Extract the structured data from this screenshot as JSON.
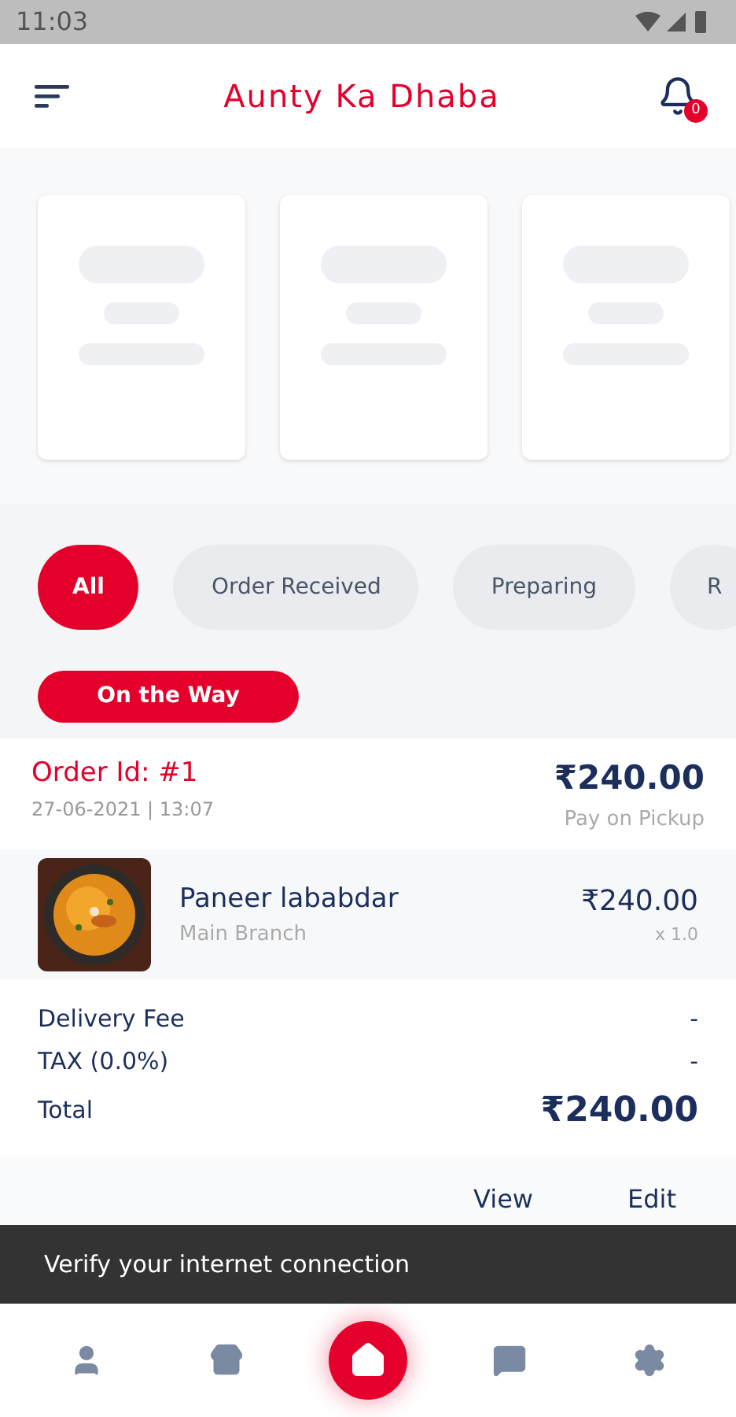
{
  "status_bar": {
    "time": "11:03"
  },
  "header": {
    "title": "Aunty Ka Dhaba",
    "notification_count": "0"
  },
  "filters": [
    {
      "label": "All",
      "selected": true
    },
    {
      "label": "Order Received",
      "selected": false
    },
    {
      "label": "Preparing",
      "selected": false
    },
    {
      "label": "R",
      "selected": false
    }
  ],
  "order": {
    "status": "On the Way",
    "id": "Order Id: #1",
    "datetime": "27-06-2021 | 13:07",
    "total": "₹240.00",
    "payment": "Pay on Pickup",
    "items": [
      {
        "kind": "picture",
        "name": "Paneer lababdar",
        "branch": "Main Branch",
        "price": "₹240.00",
        "quantity": "x 1.0"
      }
    ],
    "summary": [
      {
        "label": "Delivery Fee",
        "value": "-",
        "emphasis": false
      },
      {
        "label": "TAX (0.0%)",
        "value": "-",
        "emphasis": false
      },
      {
        "label": "Total",
        "value": "₹240.00",
        "emphasis": true
      }
    ],
    "actions": [
      "View",
      "Edit"
    ]
  },
  "snackbar": {
    "message": "Verify your internet connection"
  },
  "bottom_nav": [
    {
      "kind": "profile",
      "selected": false
    },
    {
      "kind": "store",
      "selected": false
    },
    {
      "kind": "home",
      "selected": true
    },
    {
      "kind": "chat",
      "selected": false
    },
    {
      "kind": "settings",
      "selected": false
    }
  ]
}
